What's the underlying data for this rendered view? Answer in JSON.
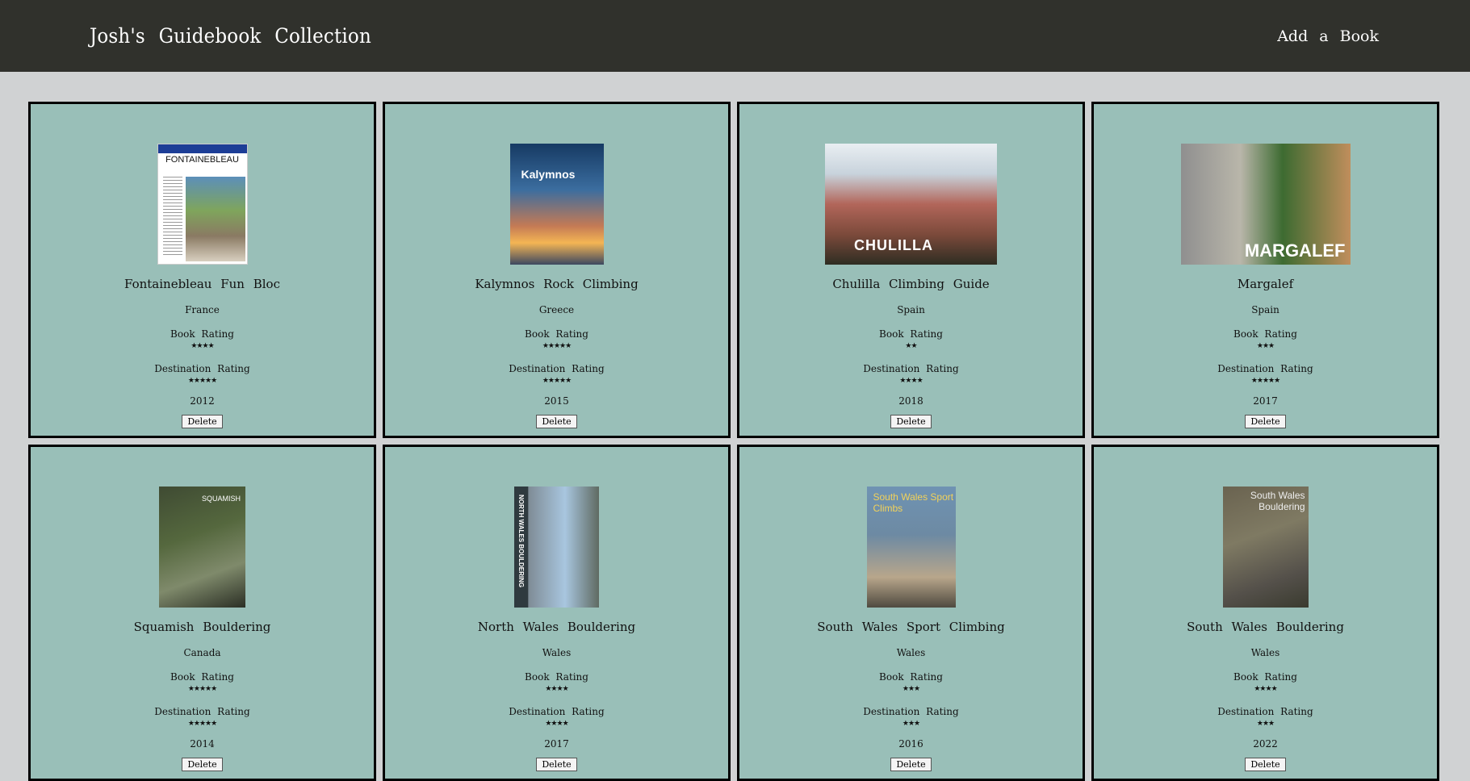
{
  "header": {
    "title": "Josh's Guidebook Collection",
    "add_link": "Add a Book"
  },
  "labels": {
    "book_rating": "Book Rating",
    "destination_rating": "Destination Rating",
    "delete": "Delete"
  },
  "books": [
    {
      "title": "Fontainebleau Fun Bloc",
      "country": "France",
      "book_rating": 4,
      "book_stars": "★★★★",
      "destination_rating": 5,
      "destination_stars": "★★★★★",
      "year": "2012",
      "cover_text": "FONTAINEBLEAU"
    },
    {
      "title": "Kalymnos Rock Climbing",
      "country": "Greece",
      "book_rating": 5,
      "book_stars": "★★★★★",
      "destination_rating": 5,
      "destination_stars": "★★★★★",
      "year": "2015",
      "cover_text": "Kalymnos"
    },
    {
      "title": "Chulilla Climbing Guide",
      "country": "Spain",
      "book_rating": 2,
      "book_stars": "★★",
      "destination_rating": 4,
      "destination_stars": "★★★★",
      "year": "2018",
      "cover_text": "CHULILLA"
    },
    {
      "title": "Margalef",
      "country": "Spain",
      "book_rating": 3,
      "book_stars": "★★★",
      "destination_rating": 5,
      "destination_stars": "★★★★★",
      "year": "2017",
      "cover_text": "MARGALEF"
    },
    {
      "title": "Squamish Bouldering",
      "country": "Canada",
      "book_rating": 5,
      "book_stars": "★★★★★",
      "destination_rating": 5,
      "destination_stars": "★★★★★",
      "year": "2014",
      "cover_text": "SQUAMISH"
    },
    {
      "title": "North Wales Bouldering",
      "country": "Wales",
      "book_rating": 4,
      "book_stars": "★★★★",
      "destination_rating": 4,
      "destination_stars": "★★★★",
      "year": "2017",
      "cover_text": "NORTH WALES BOULDERING"
    },
    {
      "title": "South Wales Sport Climbing",
      "country": "Wales",
      "book_rating": 3,
      "book_stars": "★★★",
      "destination_rating": 3,
      "destination_stars": "★★★",
      "year": "2016",
      "cover_text": "South Wales Sport Climbs"
    },
    {
      "title": "South Wales Bouldering",
      "country": "Wales",
      "book_rating": 4,
      "book_stars": "★★★★",
      "destination_rating": 3,
      "destination_stars": "★★★",
      "year": "2022",
      "cover_text": "South Wales Bouldering"
    }
  ]
}
